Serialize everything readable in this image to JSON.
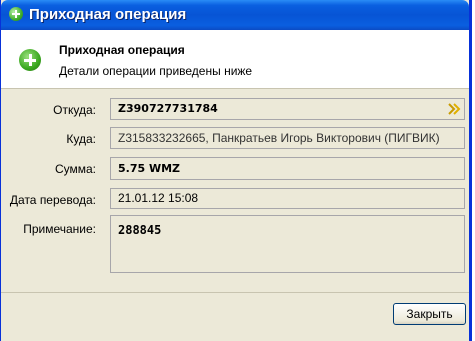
{
  "window": {
    "title": "Приходная операция"
  },
  "header": {
    "title": "Приходная операция",
    "subtitle": "Детали операции приведены ниже"
  },
  "form": {
    "from": {
      "label": "Откуда:",
      "value": "Z390727731784"
    },
    "to": {
      "label": "Куда:",
      "value": "Z315833232665, Панкратьев Игорь Викторович (ПИГВИК)"
    },
    "amount": {
      "label": "Сумма:",
      "value": "5.75 WMZ"
    },
    "date": {
      "label": "Дата перевода:",
      "value": "21.01.12 15:08"
    },
    "note": {
      "label": "Примечание:",
      "value": "288845"
    }
  },
  "buttons": {
    "close": "Закрыть"
  },
  "colors": {
    "title_bar": "#0754d5",
    "accent_icon": "#3aa81f",
    "arrow": "#d4a300"
  }
}
